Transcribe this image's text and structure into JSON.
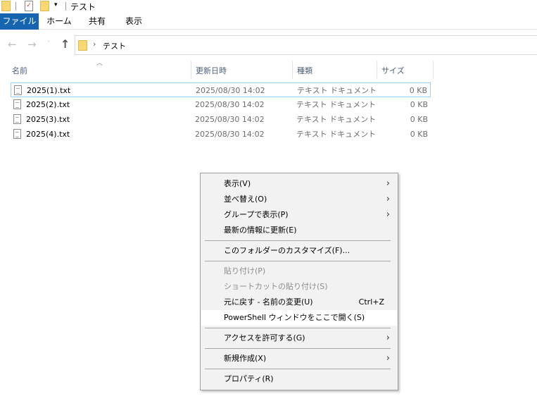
{
  "titlebar": {
    "title": "テスト"
  },
  "ribbon": {
    "tabs": [
      "ファイル",
      "ホーム",
      "共有",
      "表示"
    ]
  },
  "address": {
    "path": "テスト"
  },
  "columns": {
    "name": "名前",
    "date": "更新日時",
    "type": "種類",
    "size": "サイズ"
  },
  "files": [
    {
      "name": "2025(1).txt",
      "date": "2025/08/30 14:02",
      "type": "テキスト ドキュメント",
      "size": "0 KB"
    },
    {
      "name": "2025(2).txt",
      "date": "2025/08/30 14:02",
      "type": "テキスト ドキュメント",
      "size": "0 KB"
    },
    {
      "name": "2025(3).txt",
      "date": "2025/08/30 14:02",
      "type": "テキスト ドキュメント",
      "size": "0 KB"
    },
    {
      "name": "2025(4).txt",
      "date": "2025/08/30 14:02",
      "type": "テキスト ドキュメント",
      "size": "0 KB"
    }
  ],
  "menu": {
    "view": "表示(V)",
    "sort": "並べ替え(O)",
    "group": "グループで表示(P)",
    "refresh": "最新の情報に更新(E)",
    "customize": "このフォルダーのカスタマイズ(F)...",
    "paste": "貼り付け(P)",
    "paste_shortcut": "ショートカットの貼り付け(S)",
    "undo": "元に戻す - 名前の変更(U)",
    "undo_shortcut": "Ctrl+Z",
    "powershell": "PowerShell ウィンドウをここで開く(S)",
    "access": "アクセスを許可する(G)",
    "new": "新規作成(X)",
    "properties": "プロパティ(R)"
  }
}
